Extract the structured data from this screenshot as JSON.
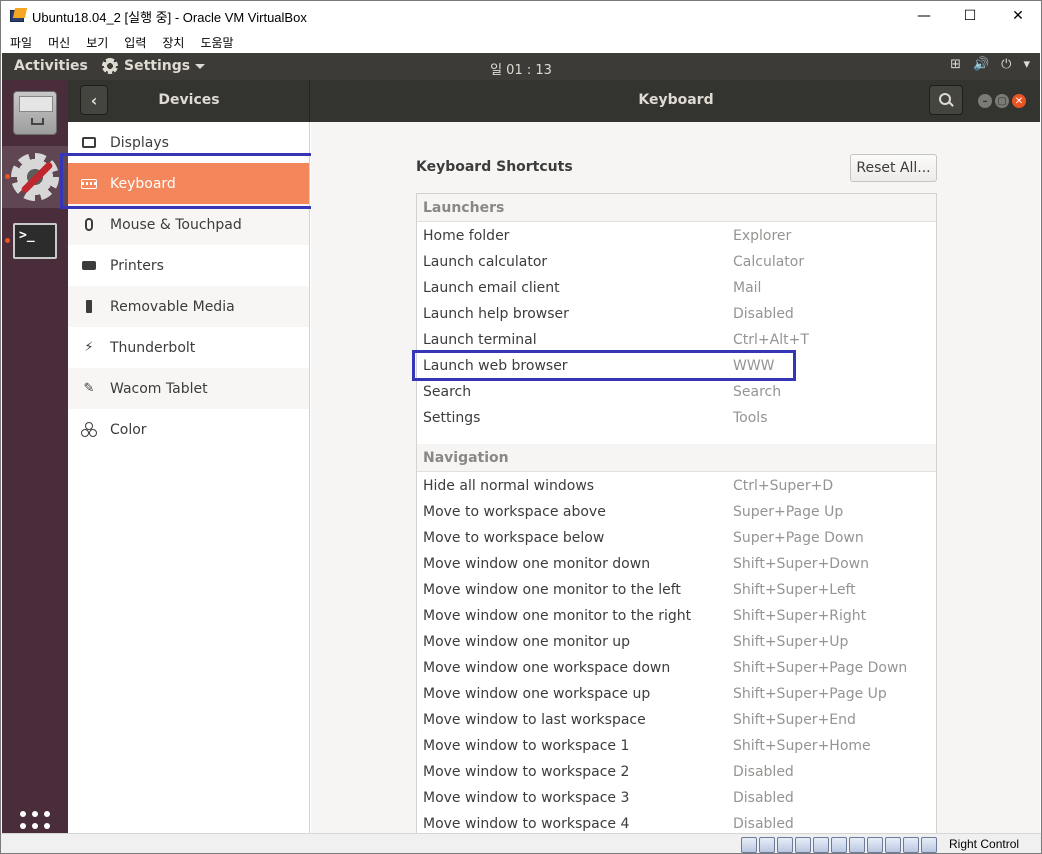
{
  "vbox": {
    "title": "Ubuntu18.04_2 [실행 중] - Oracle VM VirtualBox",
    "window_controls": {
      "minimize": "—",
      "maximize": "☐",
      "close": "✕"
    },
    "menu": [
      "파일",
      "머신",
      "보기",
      "입력",
      "장치",
      "도움말"
    ],
    "status_host_key": "Right Control"
  },
  "topbar": {
    "activities": "Activities",
    "app_menu": "Settings",
    "clock": "일 01 : 13",
    "tray": {
      "network": "⊞",
      "volume": "🔊",
      "power": "⏻",
      "arrow": "▾"
    }
  },
  "header": {
    "back": "‹",
    "sidebar_title": "Devices",
    "panel_title": "Keyboard",
    "win_buttons": {
      "minimize": "–",
      "maximize": "▢",
      "close": "✕"
    }
  },
  "sidebar": {
    "items": [
      {
        "label": "Displays",
        "icon": "display-icon"
      },
      {
        "label": "Keyboard",
        "icon": "keyboard-icon",
        "selected": true
      },
      {
        "label": "Mouse & Touchpad",
        "icon": "mouse-icon"
      },
      {
        "label": "Printers",
        "icon": "printer-icon"
      },
      {
        "label": "Removable Media",
        "icon": "usb-icon"
      },
      {
        "label": "Thunderbolt",
        "icon": "thunderbolt-icon"
      },
      {
        "label": "Wacom Tablet",
        "icon": "tablet-icon"
      },
      {
        "label": "Color",
        "icon": "color-icon"
      }
    ]
  },
  "shortcuts": {
    "title": "Keyboard Shortcuts",
    "reset_button": "Reset All...",
    "sections": [
      {
        "name": "Launchers",
        "rows": [
          {
            "name": "Home folder",
            "accel": "Explorer"
          },
          {
            "name": "Launch calculator",
            "accel": "Calculator"
          },
          {
            "name": "Launch email client",
            "accel": "Mail"
          },
          {
            "name": "Launch help browser",
            "accel": "Disabled"
          },
          {
            "name": "Launch terminal",
            "accel": "Ctrl+Alt+T"
          },
          {
            "name": "Launch web browser",
            "accel": "WWW",
            "highlighted": true
          },
          {
            "name": "Search",
            "accel": "Search"
          },
          {
            "name": "Settings",
            "accel": "Tools"
          }
        ]
      },
      {
        "name": "Navigation",
        "rows": [
          {
            "name": "Hide all normal windows",
            "accel": "Ctrl+Super+D"
          },
          {
            "name": "Move to workspace above",
            "accel": "Super+Page Up"
          },
          {
            "name": "Move to workspace below",
            "accel": "Super+Page Down"
          },
          {
            "name": "Move window one monitor down",
            "accel": "Shift+Super+Down"
          },
          {
            "name": "Move window one monitor to the left",
            "accel": "Shift+Super+Left"
          },
          {
            "name": "Move window one monitor to the right",
            "accel": "Shift+Super+Right"
          },
          {
            "name": "Move window one monitor up",
            "accel": "Shift+Super+Up"
          },
          {
            "name": "Move window one workspace down",
            "accel": "Shift+Super+Page Down"
          },
          {
            "name": "Move window one workspace up",
            "accel": "Shift+Super+Page Up"
          },
          {
            "name": "Move window to last workspace",
            "accel": "Shift+Super+End"
          },
          {
            "name": "Move window to workspace 1",
            "accel": "Shift+Super+Home"
          },
          {
            "name": "Move window to workspace 2",
            "accel": "Disabled"
          },
          {
            "name": "Move window to workspace 3",
            "accel": "Disabled"
          },
          {
            "name": "Move window to workspace 4",
            "accel": "Disabled"
          }
        ]
      }
    ]
  },
  "colors": {
    "accent": "#f3865a",
    "topbar": "#3c3b37",
    "dock": "#4a2d3b",
    "annotation": "#3535b5"
  }
}
